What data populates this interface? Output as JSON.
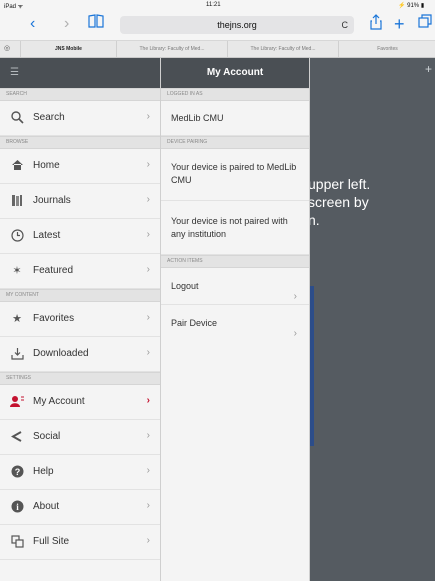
{
  "status_bar": {
    "left": "iPad ᯤ",
    "time": "11:21",
    "right": "⚡ 91% ▮"
  },
  "nav": {
    "back": "‹",
    "forward": "›",
    "bookmarks_icon": "book-icon",
    "url": "thejns.org",
    "reload": "C",
    "share_icon": "share-icon",
    "add_icon": "plus-icon",
    "tabs_icon": "tabs-icon"
  },
  "tabs": [
    {
      "label": "JNS Mobile"
    },
    {
      "label": "The Library: Faculty of Med..."
    },
    {
      "label": "The Library: Faculty of Med..."
    },
    {
      "label": "Favorites"
    }
  ],
  "page": {
    "bg_text": "upper left.\nscreen by\nn."
  },
  "left_menu": {
    "header_icon": "hamburger-icon",
    "sections": {
      "search": "SEARCH",
      "browse": "BROWSE",
      "my_content": "MY CONTENT",
      "settings": "SETTINGS"
    },
    "items": {
      "search": {
        "label": "Search",
        "icon": "magnifier-icon"
      },
      "home": {
        "label": "Home",
        "icon": "home-icon"
      },
      "journals": {
        "label": "Journals",
        "icon": "journals-icon"
      },
      "latest": {
        "label": "Latest",
        "icon": "clock-icon"
      },
      "featured": {
        "label": "Featured",
        "icon": "featured-icon"
      },
      "favorites": {
        "label": "Favorites",
        "icon": "star-icon"
      },
      "downloaded": {
        "label": "Downloaded",
        "icon": "download-icon"
      },
      "my_account": {
        "label": "My Account",
        "icon": "account-icon"
      },
      "social": {
        "label": "Social",
        "icon": "share-icon"
      },
      "help": {
        "label": "Help",
        "icon": "help-icon"
      },
      "about": {
        "label": "About",
        "icon": "info-icon"
      },
      "full_site": {
        "label": "Full Site",
        "icon": "full-site-icon"
      }
    },
    "chevron": "›"
  },
  "right_panel": {
    "title": "My Account",
    "sections": {
      "logged_in": "LOGGED IN AS",
      "device_pairing": "DEVICE PAIRING",
      "action_items": "ACTION ITEMS"
    },
    "logged_in_as": "MedLib CMU",
    "pairing_1": "Your device is paired to MedLib CMU",
    "pairing_2": "Your device is not paired with any institution",
    "actions": {
      "logout": "Logout",
      "pair_device": "Pair Device"
    },
    "chevron": "›"
  },
  "colors": {
    "accent": "#1a75d8",
    "brand_red": "#c4122f",
    "header": "#4a4f54"
  }
}
